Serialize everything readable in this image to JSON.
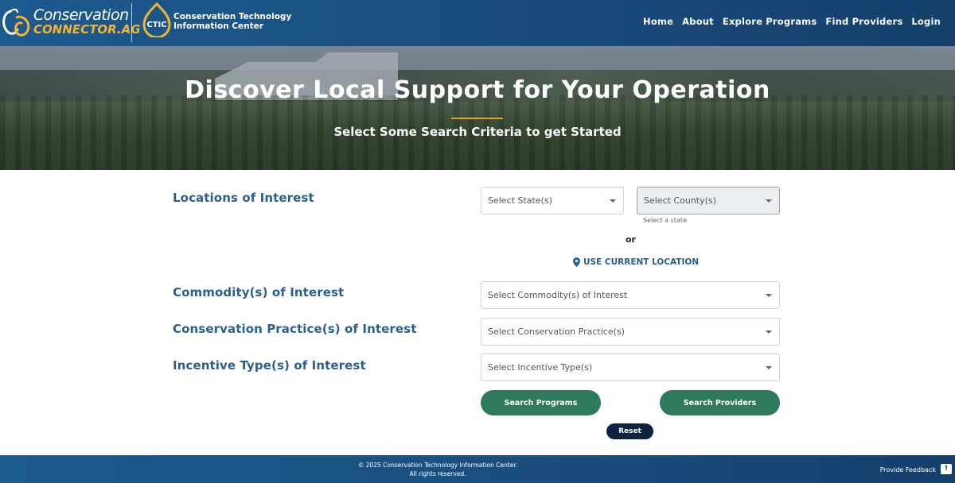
{
  "header": {
    "logo_line1": "Conservation",
    "logo_line2": "CONNECTOR.AG",
    "ctic_badge": "CTIC",
    "ctic_line1": "Conservation Technology",
    "ctic_line2": "Information Center",
    "nav": [
      "Home",
      "About",
      "Explore Programs",
      "Find Providers",
      "Login"
    ]
  },
  "hero": {
    "title": "Discover Local Support for Your Operation",
    "subtitle": "Select Some Search Criteria to get Started"
  },
  "form": {
    "locations_label": "Locations of Interest",
    "state_placeholder": "Select State(s)",
    "county_placeholder": "Select County(s)",
    "county_helper": "Select a state",
    "or_text": "or",
    "use_location": "USE CURRENT LOCATION",
    "commodity_label": "Commodity(s) of Interest",
    "commodity_placeholder": "Select Commodity(s) of Interest",
    "practice_label": "Conservation Practice(s) of Interest",
    "practice_placeholder": "Select Conservation Practice(s)",
    "incentive_label": "Incentive Type(s) of Interest",
    "incentive_placeholder": "Select Incentive Type(s)",
    "search_programs": "Search Programs",
    "search_providers": "Search Providers",
    "reset": "Reset"
  },
  "footer": {
    "copyright": "© 2025 Conservation Technology Information Center.",
    "rights": "All rights reserved.",
    "feedback": "Provide Feedback",
    "feedback_icon": "!"
  },
  "colors": {
    "header_blue": "#1a4f80",
    "label_blue": "#2a5f8f",
    "accent_gold": "#e2a42f",
    "button_green": "#2f7a5a",
    "reset_navy": "#0f2340"
  }
}
